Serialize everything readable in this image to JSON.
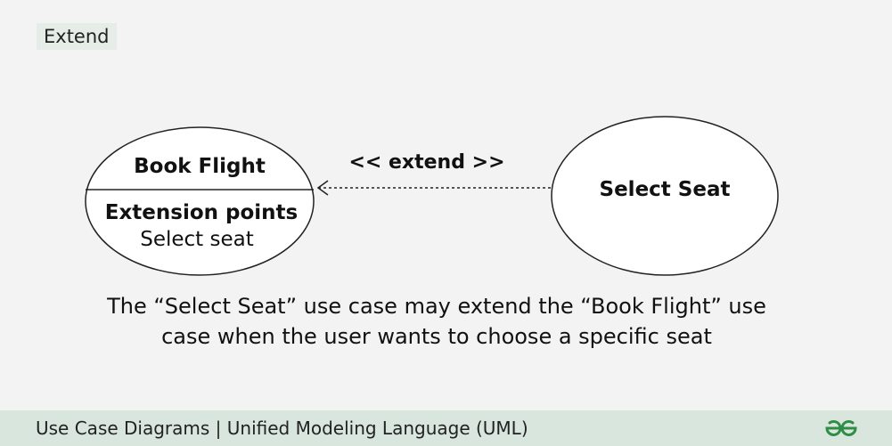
{
  "tag": {
    "label": "Extend"
  },
  "diagram": {
    "base_use_case": {
      "name": "Book Flight",
      "section_header": "Extension points",
      "extension_point": "Select seat"
    },
    "extending_use_case": {
      "name": "Select Seat"
    },
    "relationship": {
      "label": "<< extend >>",
      "line_style": "dashed",
      "arrow": "open-arrow-to-base"
    }
  },
  "caption": {
    "line1": "The “Select Seat” use case may extend the “Book Flight” use",
    "line2": "case  when the user wants to choose a specific seat"
  },
  "footer": {
    "title": "Use Case Diagrams | Unified Modeling Language (UML)",
    "logo_icon": "geeksforgeeks-logo-icon"
  },
  "colors": {
    "background": "#f3f3f3",
    "footer_bar": "#d8e6dd",
    "tag_background": "#e6ede8",
    "brand_green": "#2f8d46"
  }
}
